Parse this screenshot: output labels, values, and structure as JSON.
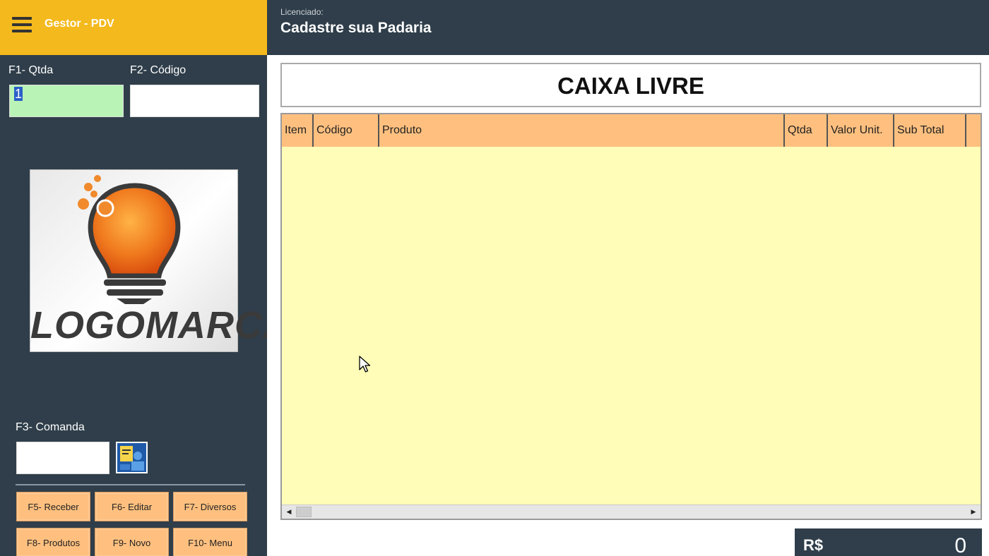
{
  "app": {
    "title": "Gestor - PDV"
  },
  "header": {
    "licensed_label": "Licenciado:",
    "licensed_name": "Cadastre sua Padaria"
  },
  "fields": {
    "qtd": {
      "label": "F1- Qtda",
      "value": "1"
    },
    "codigo": {
      "label": "F2- Código",
      "value": ""
    },
    "comanda": {
      "label": "F3- Comanda",
      "value": ""
    }
  },
  "logo": {
    "text": "LOGOMARCA"
  },
  "status": {
    "text": "CAIXA LIVRE"
  },
  "table": {
    "columns": [
      "Item",
      "Código",
      "Produto",
      "Qtda",
      "Valor Unit.",
      "Sub Total"
    ],
    "rows": []
  },
  "buttons": [
    {
      "label": "F5- Receber",
      "name": "receber-button"
    },
    {
      "label": "F6- Editar",
      "name": "editar-button"
    },
    {
      "label": "F7- Diversos",
      "name": "diversos-button"
    },
    {
      "label": "F8- Produtos",
      "name": "produtos-button"
    },
    {
      "label": "F9- Novo",
      "name": "novo-button"
    },
    {
      "label": "F10- Menu",
      "name": "menu-button"
    }
  ],
  "total": {
    "currency": "R$",
    "value": "0"
  },
  "colors": {
    "brand": "#f4b91d",
    "dark": "#2f3e4a",
    "qtd_field": "#b9f4b6",
    "grid_header": "#ffc07f",
    "grid_body": "#fffdb7"
  }
}
